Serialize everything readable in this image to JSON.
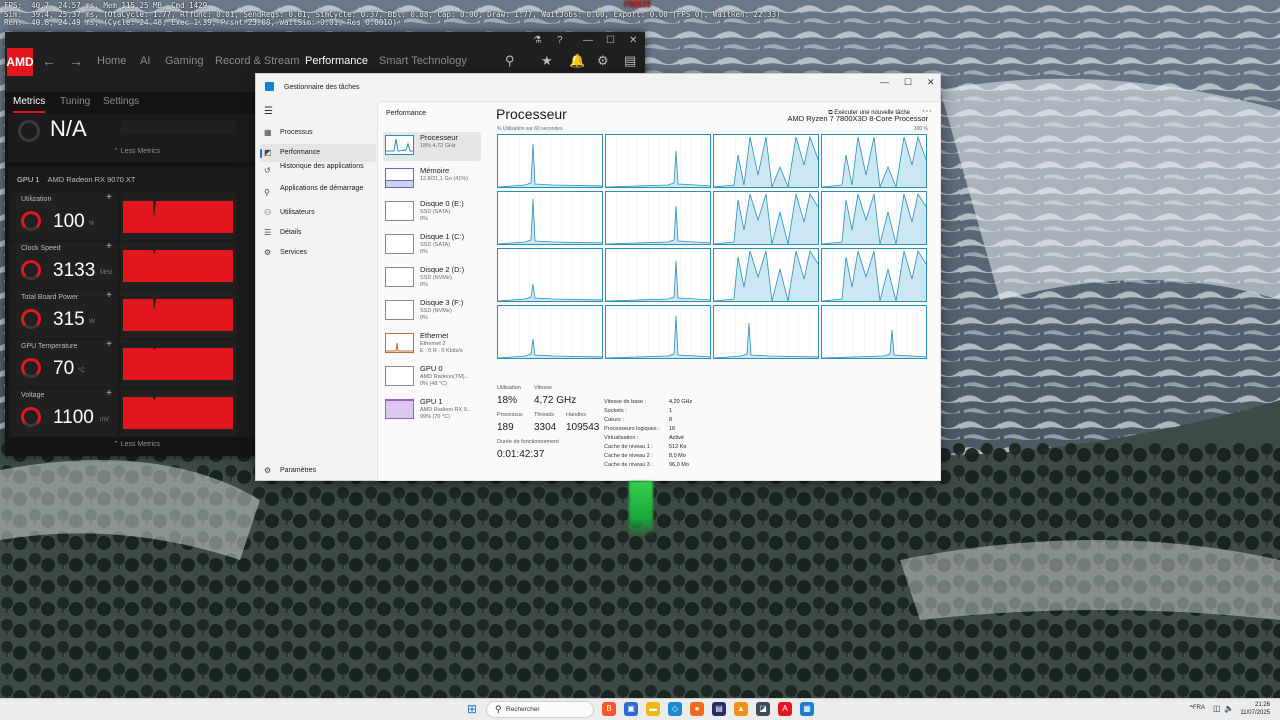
{
  "debug": {
    "line1": "FPS:  40.7, 24.57 ms, Mem 115.25 MB, Cmd 1429",
    "line2": "Sim:  39.4, 25.37 ms, (OtaCycle: 1.77, RTfunc: 0.01, SendRegs: 0.01, SimCycle: 0.37, Bbl: 0.88, Cap: 0.00, Draw: 1.77, WaitJobs: 0.00, Export: 0.00 (FPS 0), WaitRen: 22.33)",
    "line3": "Ren:  40.8, 24.49 ms, (Cycle: 24.48, Exec 1.39, Prsnt 23.08, WaitSim: 0.01, Res 0.0010)",
    "freeze": "FREEZE"
  },
  "amd": {
    "logo": "AMD",
    "nav": [
      "Home",
      "AI",
      "Gaming",
      "Record & Stream",
      "Performance",
      "Smart Technology"
    ],
    "active_nav": "Performance",
    "subtabs": [
      "Metrics",
      "Tuning",
      "Settings"
    ],
    "top_metric": {
      "value": "N/A"
    },
    "less_label": "Less Metrics",
    "gpu": {
      "label": "GPU 1",
      "name": "AMD Radeon RX 9070 XT"
    },
    "metrics": [
      {
        "label": "Utilization",
        "value": "100",
        "unit": "%"
      },
      {
        "label": "Clock Speed",
        "value": "3133",
        "unit": "MHz"
      },
      {
        "label": "Total Board Power",
        "value": "315",
        "unit": "W"
      },
      {
        "label": "GPU Temperature",
        "value": "70",
        "unit": "°C"
      },
      {
        "label": "Voltage",
        "value": "1100",
        "unit": "mV"
      }
    ],
    "accent": "#e3161f"
  },
  "taskmgr": {
    "title": "Gestionnaire des tâches",
    "nav": [
      {
        "icon": "processes-icon",
        "glyph": "▦",
        "label": "Processus"
      },
      {
        "icon": "performance-icon",
        "glyph": "◩",
        "label": "Performance"
      },
      {
        "icon": "app-history-icon",
        "glyph": "↺",
        "label": "Historique des applications"
      },
      {
        "icon": "startup-apps-icon",
        "glyph": "⚲",
        "label": "Applications de démarrage"
      },
      {
        "icon": "users-icon",
        "glyph": "⚇",
        "label": "Utilisateurs"
      },
      {
        "icon": "details-icon",
        "glyph": "☰",
        "label": "Détails"
      },
      {
        "icon": "services-icon",
        "glyph": "⚙",
        "label": "Services"
      }
    ],
    "settings_label": "Paramètres",
    "header": "Performance",
    "new_task": "Exécuter une nouvelle tâche",
    "list": [
      {
        "name": "Processeur",
        "sub1": "18% 4,72 GHz",
        "sub2": ""
      },
      {
        "name": "Mémoire",
        "sub1": "12,8/31,1 Go (41%)",
        "sub2": ""
      },
      {
        "name": "Disque 0 (E:)",
        "sub1": "SSD (SATA)",
        "sub2": "0%"
      },
      {
        "name": "Disque 1 (C:)",
        "sub1": "SSD (SATA)",
        "sub2": "0%"
      },
      {
        "name": "Disque 2 (D:)",
        "sub1": "SSD (NVMe)",
        "sub2": "0%"
      },
      {
        "name": "Disque 3 (F:)",
        "sub1": "SSD (NVMe)",
        "sub2": "0%"
      },
      {
        "name": "Ethernet",
        "sub1": "Ethernet 2",
        "sub2": "E : 0 R : 0 Kbits/s"
      },
      {
        "name": "GPU 0",
        "sub1": "AMD Radeon(TM)...",
        "sub2": "0% (48 °C)"
      },
      {
        "name": "GPU 1",
        "sub1": "AMD Radeon RX 9...",
        "sub2": "99% (70 °C)"
      }
    ],
    "cpu": {
      "title": "Processeur",
      "model": "AMD Ryzen 7 7800X3D 8-Core Processor",
      "graph_caption": "% Utilisation sur 60 secondes",
      "graph_max": "100 %",
      "stats": [
        {
          "label": "Utilisation",
          "value": "18%"
        },
        {
          "label": "Vitesse",
          "value": "4,72 GHz"
        },
        {
          "label": "Processus",
          "value": "189"
        },
        {
          "label": "Threads",
          "value": "3304"
        },
        {
          "label": "Handles",
          "value": "109543"
        },
        {
          "label": "Durée de fonctionnement",
          "value": "0:01:42:37"
        }
      ],
      "specs": [
        {
          "label": "Vitesse de base :",
          "value": "4,20 GHz"
        },
        {
          "label": "Sockets :",
          "value": "1"
        },
        {
          "label": "Cœurs :",
          "value": "8"
        },
        {
          "label": "Processeurs logiques :",
          "value": "16"
        },
        {
          "label": "Virtualisation :",
          "value": "Activé"
        },
        {
          "label": "Cache de niveau 1 :",
          "value": "512 Ko"
        },
        {
          "label": "Cache de niveau 2 :",
          "value": "8,0 Mo"
        },
        {
          "label": "Cache de niveau 3 :",
          "value": "96,0 Mo"
        }
      ]
    },
    "accent": "#2b8fb6"
  },
  "taskbar": {
    "search_placeholder": "Rechercher",
    "apps": [
      {
        "icon": "brave-icon",
        "color": "#fb542b",
        "glyph": "B"
      },
      {
        "icon": "store-icon",
        "color": "#2d6bd3",
        "glyph": "▣"
      },
      {
        "icon": "explorer-icon",
        "color": "#f2b90c",
        "glyph": "▬"
      },
      {
        "icon": "vscode-icon",
        "color": "#1a8ad4",
        "glyph": "◇"
      },
      {
        "icon": "firefox-icon",
        "color": "#f36a1c",
        "glyph": "●"
      },
      {
        "icon": "app-icon",
        "color": "#2b2b6b",
        "glyph": "▤"
      },
      {
        "icon": "vlc-icon",
        "color": "#f09016",
        "glyph": "▲"
      },
      {
        "icon": "app2-icon",
        "color": "#3a4a5a",
        "glyph": "◪"
      },
      {
        "icon": "amd-icon",
        "color": "#e3161f",
        "glyph": "A"
      },
      {
        "icon": "taskmgr-icon",
        "color": "#1a7fd2",
        "glyph": "▦"
      }
    ],
    "language": "FRA",
    "time": "21:26",
    "date": "11/07/2025"
  }
}
